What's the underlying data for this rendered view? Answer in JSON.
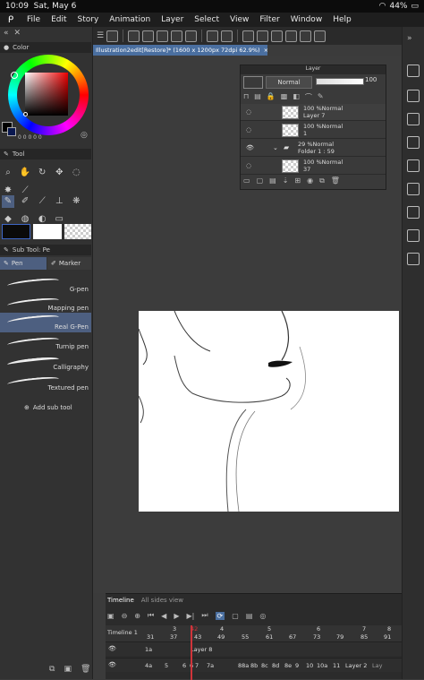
{
  "status_bar": {
    "time": "10:09",
    "date": "Sat, May 6",
    "battery": "44%"
  },
  "menu": [
    "File",
    "Edit",
    "Story",
    "Animation",
    "Layer",
    "Select",
    "View",
    "Filter",
    "Window",
    "Help"
  ],
  "color_panel": {
    "title": "Color",
    "values": "0 0 0 0 0"
  },
  "tool_panel": {
    "title": "Tool"
  },
  "subtool_panel": {
    "title": "Sub Tool: Pe",
    "tabs": [
      "Pen",
      "Marker"
    ],
    "brushes": [
      "G-pen",
      "Mapping pen",
      "Real G-Pen",
      "Turnip pen",
      "Calligraphy",
      "Textured pen"
    ],
    "add_label": "Add sub tool"
  },
  "document_tab": "Illustration2edit[Restore]* (1600 x 1200px 72dpi 62.9%)",
  "layer_panel": {
    "title": "Layer",
    "blend_mode": "Normal",
    "opacity": "100",
    "rows": [
      {
        "line1": "100 %Normal",
        "line2": "Layer 7"
      },
      {
        "line1": "100 %Normal",
        "line2": "1"
      },
      {
        "line1": "29 %Normal",
        "line2": "Folder 1 : 59"
      },
      {
        "line1": "100 %Normal",
        "line2": "37"
      }
    ]
  },
  "timeline": {
    "tabs": [
      "Timeline",
      "All sides view"
    ],
    "name": "Timeline 1",
    "frames_top": [
      "3",
      "42",
      "4",
      "5",
      "6",
      "7",
      "8"
    ],
    "frames_bottom": [
      "31",
      "37",
      "43",
      "49",
      "55",
      "61",
      "67",
      "73",
      "79",
      "85",
      "91"
    ],
    "row1": {
      "label": "1a",
      "layer": "Layer 8"
    },
    "row2": [
      "4a",
      "5",
      "6",
      "6",
      "7",
      "7a",
      "88a",
      "8b",
      "8c",
      "8d",
      "8e",
      "9",
      "10",
      "10a",
      "11",
      "Layer 2",
      "Lay"
    ]
  },
  "colors": {
    "accent": "#4a6fa0",
    "playhead": "#d0343a",
    "selected_brush": "#4d5f80"
  }
}
